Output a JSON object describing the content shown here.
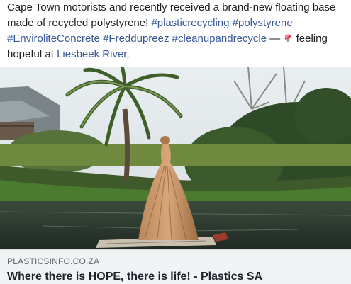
{
  "post": {
    "line1": "Cape Town motorists and recently received a brand-new floating base",
    "line2_text": "made of recycled polystyrene! ",
    "hashtags": {
      "plasticrecycling": "#plasticrecycling",
      "polystyrene": "#polystyrene",
      "envirolite": "#EnviroliteConcrete",
      "freddupreez": "#Freddupreez",
      "cleanup": "#cleanupandrecycle"
    },
    "dash": " — ",
    "feeling": " feeling",
    "line4_prefix": "hopeful at ",
    "location": "Liesbeek River",
    "location_suffix": ".",
    "feeling_icon": "flower-emoji"
  },
  "link_preview": {
    "domain": "PLASTICSINFO.CO.ZA",
    "title": "Where there is HOPE, there is life! - Plastics SA"
  },
  "colors": {
    "link": "#385898",
    "preview_bg": "#f2f3f5"
  }
}
